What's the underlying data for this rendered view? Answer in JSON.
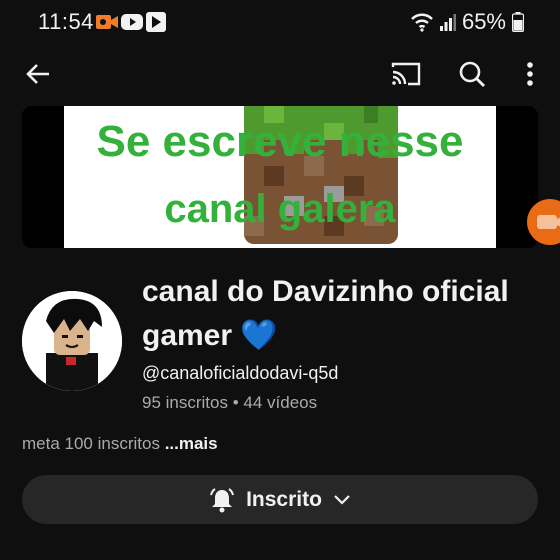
{
  "status_bar": {
    "time": "11:54",
    "battery": "65%",
    "notification_icons": [
      "screen-recorder-icon",
      "youtube-icon",
      "play-store-icon"
    ]
  },
  "app_bar": {
    "icons": [
      "back-arrow-icon",
      "cast-icon",
      "search-icon",
      "more-vert-icon"
    ]
  },
  "banner": {
    "line1": "Se escreve nesse",
    "line2": "canal galera"
  },
  "channel": {
    "name": "canal do Davizinho oficial gamer 💙",
    "handle": "@canaloficialdodavi-q5d",
    "stats": "95 inscritos • 44 vídeos",
    "description": "meta 100 inscritos",
    "more_label": "...mais"
  },
  "subscribe_button": {
    "label": "Inscrito"
  },
  "colors": {
    "background": "#0f0f0f",
    "banner_text": "#33b13b",
    "button_bg": "#272727",
    "float_button": "#e96b16"
  }
}
